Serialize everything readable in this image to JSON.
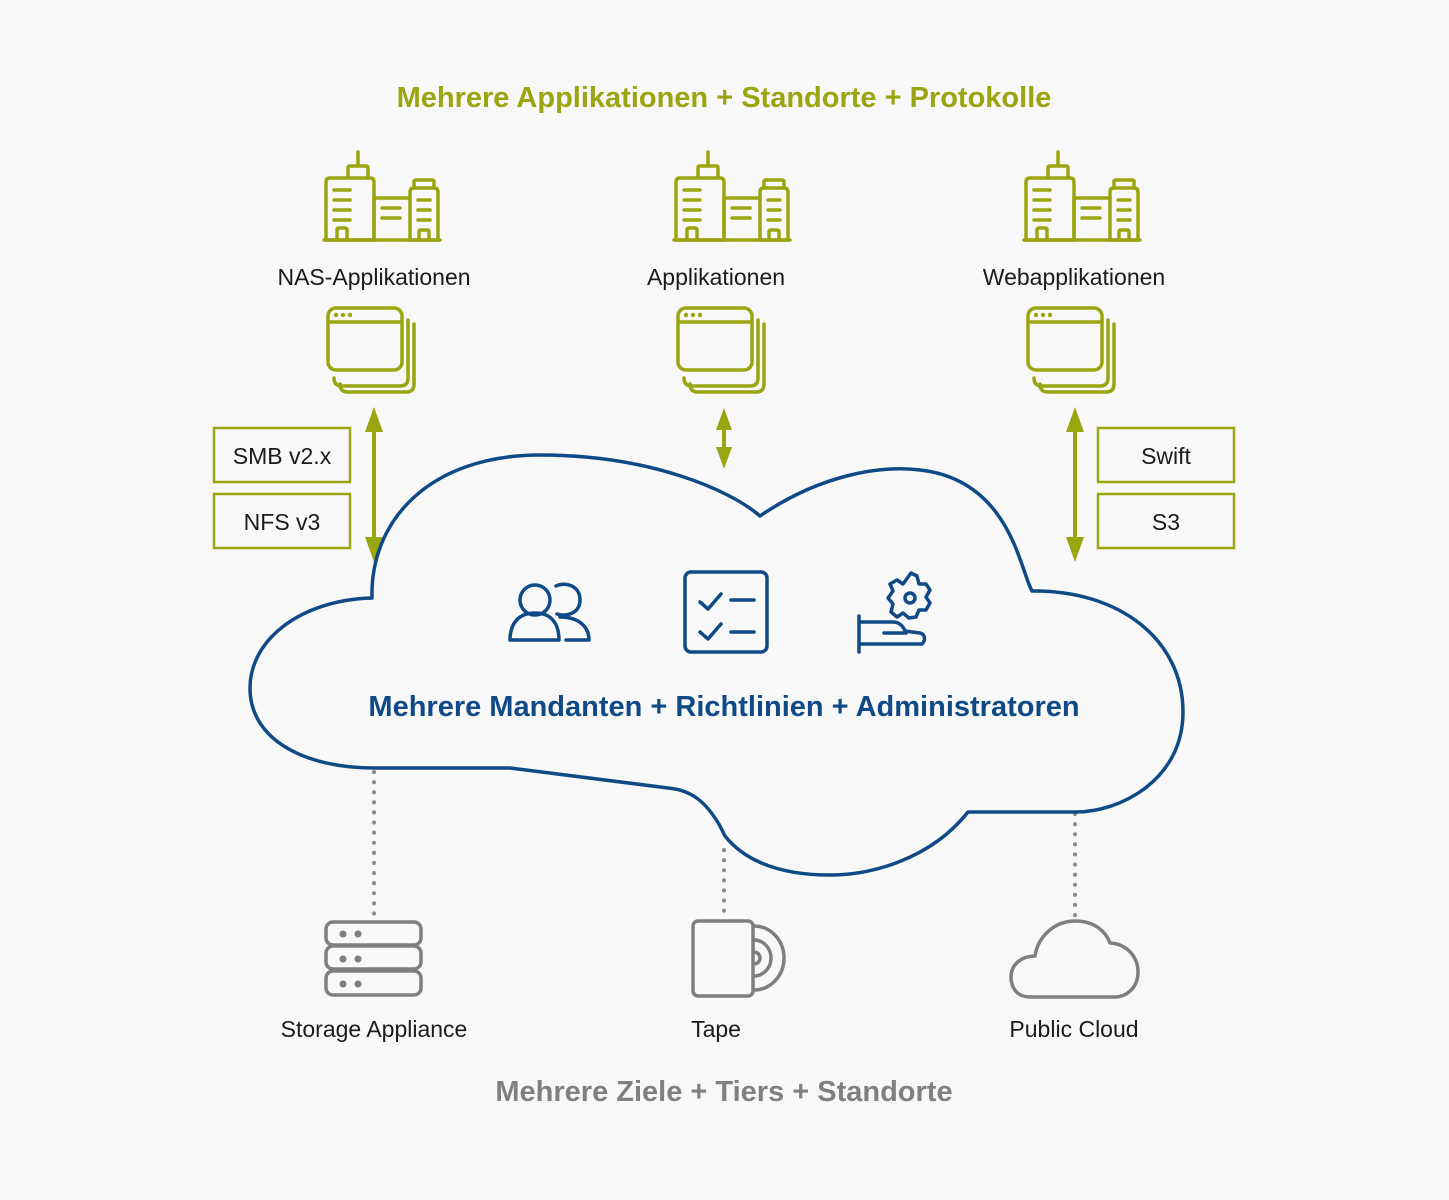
{
  "header": {
    "title": "Mehrere Applikationen + Standorte + Protokolle"
  },
  "sources": [
    {
      "label": "NAS-Applikationen",
      "building_icon": "office-buildings-icon",
      "window_icon": "stacked-windows-icon",
      "connection": "bidirectional-arrow"
    },
    {
      "label": "Applikationen",
      "building_icon": "office-buildings-icon",
      "window_icon": "stacked-windows-icon",
      "connection": "bidirectional-arrow"
    },
    {
      "label": "Webapplikationen",
      "building_icon": "office-buildings-icon",
      "window_icon": "stacked-windows-icon",
      "connection": "bidirectional-arrow"
    }
  ],
  "protocols": {
    "left": [
      "SMB v2.x",
      "NFS v3"
    ],
    "right": [
      "Swift",
      "S3"
    ]
  },
  "cloud": {
    "title": "Mehrere Mandanten + Richtlinien + Administratoren",
    "icons": [
      "users-icon",
      "checklist-icon",
      "hand-gear-icon"
    ]
  },
  "targets": [
    {
      "label": "Storage Appliance",
      "icon": "server-stack-icon",
      "connection": "dotted-line"
    },
    {
      "label": "Tape",
      "icon": "tape-icon",
      "connection": "dotted-line"
    },
    {
      "label": "Public Cloud",
      "icon": "cloud-icon",
      "connection": "dotted-line"
    }
  ],
  "footer": {
    "title": "Mehrere Ziele + Tiers + Standorte"
  },
  "colors": {
    "accent_green": "#9aa50f",
    "accent_blue": "#0f4a86",
    "neutral_gray": "#7f7f7f",
    "background": "#f8f8f8"
  }
}
